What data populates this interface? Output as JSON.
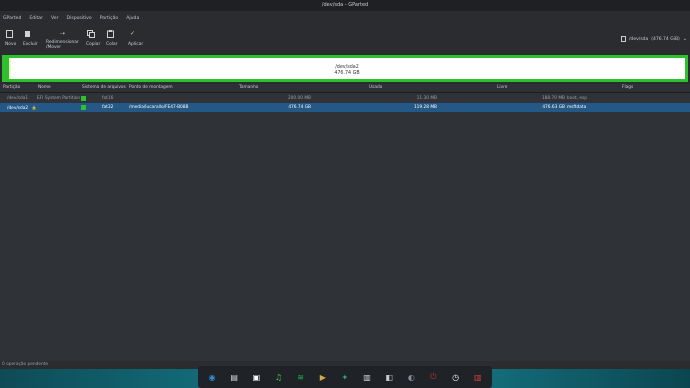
{
  "window": {
    "title": "/dev/sda - GParted"
  },
  "menu": [
    "GParted",
    "Editar",
    "Ver",
    "Dispositivo",
    "Partição",
    "Ajuda"
  ],
  "toolbar": {
    "new_label": "Novo",
    "delete_label": "Excluir",
    "resize_label_1": "Redimensionar",
    "resize_label_2": "/Mover",
    "copy_label": "Copiar",
    "paste_label": "Colar",
    "apply_label": "Aplicar"
  },
  "device_selector": {
    "device": "/dev/sda",
    "size": "(476.74 GiB)"
  },
  "disk_map": {
    "partition": "/dev/sda2",
    "size": "476.74 GB",
    "used_fraction": 0.0025
  },
  "table": {
    "headers": {
      "partition": "Partição",
      "name": "Nome",
      "filesystem": "Sistema de arquivos",
      "mountpoint": "Ponto de montagem",
      "size": "Tamanho",
      "used": "Usado",
      "free": "Livre",
      "flags": "Flags"
    },
    "rows": [
      {
        "partition": "/dev/sda1",
        "name": "EFI System Partition",
        "filesystem": "fat16",
        "mountpoint": "",
        "size": "200.00 MB",
        "used": "11.30 MB",
        "free": "188.70 MB",
        "flags": "boot, esp",
        "fs_color": "#2ec12e"
      },
      {
        "partition": "/dev/sda2",
        "name": "",
        "filesystem": "fat32",
        "mountpoint": "/media/lucarallo/FE47-B08B",
        "size": "476.74 GB",
        "used": "119.28 MB",
        "free": "476.63 GB",
        "flags": "msftdata",
        "fs_color": "#2ec12e"
      }
    ]
  },
  "status": {
    "text": "0 operação pendente"
  },
  "dock": {
    "apps": [
      {
        "icon": "launcher-icon",
        "color": "#2f8fd8"
      },
      {
        "icon": "files-icon",
        "color": "#d9d9d9"
      },
      {
        "icon": "store-icon",
        "color": "#ffffff"
      },
      {
        "icon": "music-icon",
        "color": "#58c94a"
      },
      {
        "icon": "spotify-icon",
        "color": "#1db954"
      },
      {
        "icon": "video-icon",
        "color": "#d8a74a"
      },
      {
        "icon": "gamepad-icon",
        "color": "#3aa37b"
      },
      {
        "icon": "monitor-icon",
        "color": "#d9d9d9"
      },
      {
        "icon": "disk-utility-icon",
        "color": "#c9c9c9"
      },
      {
        "icon": "settings-icon",
        "color": "#8a8f96"
      },
      {
        "icon": "power-icon",
        "color": "#d32f2f"
      },
      {
        "icon": "clock-icon",
        "color": "#f4f4f4"
      },
      {
        "icon": "trash-icon",
        "color": "#d8433b"
      }
    ]
  }
}
